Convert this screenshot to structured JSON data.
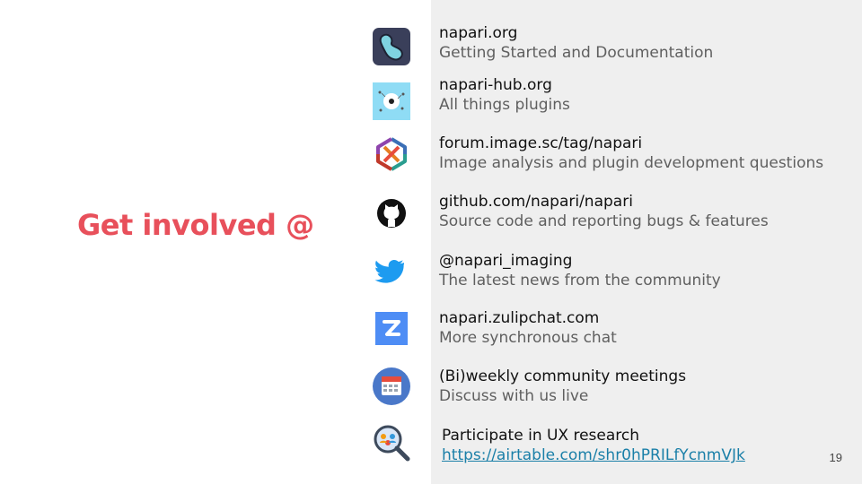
{
  "slide": {
    "headline": "Get involved @",
    "page_number": "19",
    "colors": {
      "accent": "#e8505b",
      "panel_bg": "#efefef",
      "link": "#1a7fa8"
    }
  },
  "items": [
    {
      "icon": "napari-logo-icon",
      "title": "napari.org",
      "desc": "Getting Started and Documentation"
    },
    {
      "icon": "napari-hub-icon",
      "title": "napari-hub.org",
      "desc": "All things plugins"
    },
    {
      "icon": "image-sc-forum-icon",
      "title": "forum.image.sc/tag/napari",
      "desc": "Image analysis and plugin development  questions"
    },
    {
      "icon": "github-icon",
      "title": "github.com/napari/napari",
      "desc": "Source code and reporting bugs & features"
    },
    {
      "icon": "twitter-icon",
      "title": "@napari_imaging",
      "desc": "The latest news from the community"
    },
    {
      "icon": "zulip-icon",
      "title": "napari.zulipchat.com",
      "desc": "More synchronous chat"
    },
    {
      "icon": "calendar-icon",
      "title": "(Bi)weekly community meetings",
      "desc": "Discuss with us live"
    },
    {
      "icon": "ux-research-icon",
      "title": "Participate in UX research",
      "desc": "https://airtable.com/shr0hPRILfYcnmVJk"
    }
  ]
}
